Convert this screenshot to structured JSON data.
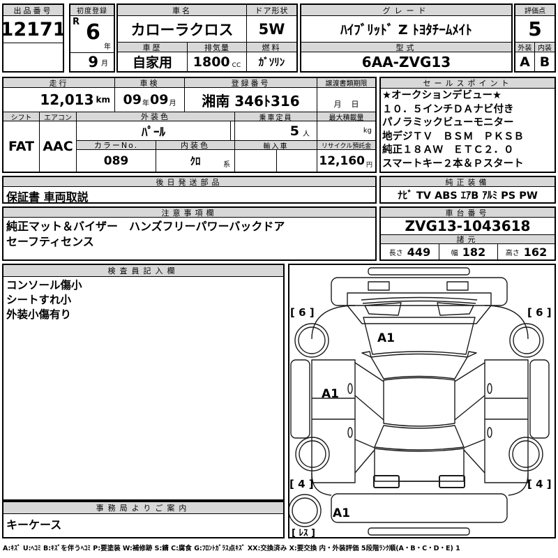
{
  "colors": {
    "header_bg": "#d8d8d8",
    "border": "#000000",
    "ink": "#000000"
  },
  "top": {
    "lot": {
      "label": "出品番号",
      "value": "12171"
    },
    "first_reg": {
      "label": "初度登録",
      "era": "R",
      "year": "6",
      "year_unit": "年",
      "month": "9",
      "month_unit": "月"
    },
    "car_name": {
      "label": "車名",
      "value": "カローラクロス"
    },
    "door": {
      "label": "ドア形状",
      "value": "5W"
    },
    "grade": {
      "label": "グレード",
      "value": "ﾊｲﾌﾞﾘｯﾄﾞ Z ﾄﾖﾀﾁｰﾑﾒｲﾄ"
    },
    "score": {
      "label": "評価点",
      "value": "5"
    },
    "history": {
      "label": "車歴",
      "value": "自家用"
    },
    "displacement": {
      "label": "排気量",
      "value": "1800",
      "unit": "CC"
    },
    "fuel": {
      "label": "燃料",
      "value": "ｶﾞｿﾘﾝ"
    },
    "model_code": {
      "label": "型式",
      "value": "6AA-ZVG13"
    },
    "exterior": {
      "label": "外装",
      "value": "A"
    },
    "interior": {
      "label": "内装",
      "value": "B"
    }
  },
  "middle": {
    "mileage": {
      "label": "走行",
      "value": "12,013",
      "unit": "km"
    },
    "inspection": {
      "label": "車検",
      "year": "09",
      "year_unit": "年",
      "month": "09",
      "month_unit": "月"
    },
    "reg_number": {
      "label": "登録番号",
      "value": "湘南 346ﾄ316"
    },
    "transfer_deadline": {
      "label": "譲渡書類期限",
      "month_unit": "月",
      "day_unit": "日"
    },
    "shift": {
      "label": "シフト",
      "value": "FAT"
    },
    "aircon": {
      "label": "エアコン",
      "value": "AAC"
    },
    "ext_color": {
      "label": "外装色",
      "value": "ﾊﾟｰﾙ"
    },
    "capacity": {
      "label": "乗車定員",
      "value": "5",
      "unit": "人"
    },
    "max_load": {
      "label": "最大積載量",
      "unit": "kg"
    },
    "color_no": {
      "label": "カラーNo.",
      "value": "089"
    },
    "int_color": {
      "label": "内装色",
      "value": "ｸﾛ",
      "suffix": "系"
    },
    "import_car": {
      "label": "輸入車"
    },
    "recycle": {
      "label": "リサイクル預託金",
      "value": "12,160",
      "unit": "円"
    }
  },
  "sales_points": {
    "label": "セールスポイント",
    "lines": [
      "★オークションデビュー★",
      "１０．５インチＤＡナビ付き",
      "パノラミックビューモニター",
      "地デジＴＶ　ＢＳＭ　ＰＫＳＢ",
      "純正１８ＡＷ　ＥＴＣ２．０",
      "スマートキー２本＆Ｐスタート"
    ]
  },
  "later_parts": {
    "label": "後日発送部品",
    "value": "保証書 車両取説"
  },
  "oem_equipment": {
    "label": "純正装備",
    "value": "ﾅﾋﾞ TV ABS ｴｱB ｱﾙﾐ PS PW"
  },
  "notes": {
    "label": "注意事項欄",
    "lines": [
      "純正マット＆バイザー　ハンズフリーパワーバックドア",
      "セーフティセンス"
    ]
  },
  "chassis": {
    "label": "車台番号",
    "value": "ZVG13-1043618"
  },
  "specs": {
    "label": "諸元",
    "length": {
      "label": "長さ",
      "value": "449"
    },
    "width": {
      "label": "幅",
      "value": "182"
    },
    "height": {
      "label": "高さ",
      "value": "162"
    }
  },
  "inspector": {
    "label": "検査員記入欄",
    "lines": [
      "コンソール傷小",
      "シートすれ小",
      "外装小傷有り"
    ]
  },
  "office": {
    "label": "事務局よりご案内",
    "value": "キーケース"
  },
  "diagram": {
    "tire_front_left": "[ 6 ]",
    "tire_front_right": "[ 6 ]",
    "tire_rear_left": "[ 4 ]",
    "tire_rear_right": "[ 4 ]",
    "spare_tire": "[ ﾚｽ ]",
    "mark_hood": "A1",
    "mark_left_door": "A1",
    "mark_rear_bumper": "A1"
  },
  "footer": {
    "legend": "A:ｷｽﾞ U:ﾍｺﾐ B:ｷｽﾞを伴うﾍｺﾐ P:要塗装 W:補修跡 S:錆 C:腐食 G:ﾌﾛﾝﾄｶﾞﾗｽ点ｷｽﾞ XX:交換済み X:要交換  内・外装評価 5段階ﾗﾝｸ順(A・B・C・D・E) 1"
  }
}
